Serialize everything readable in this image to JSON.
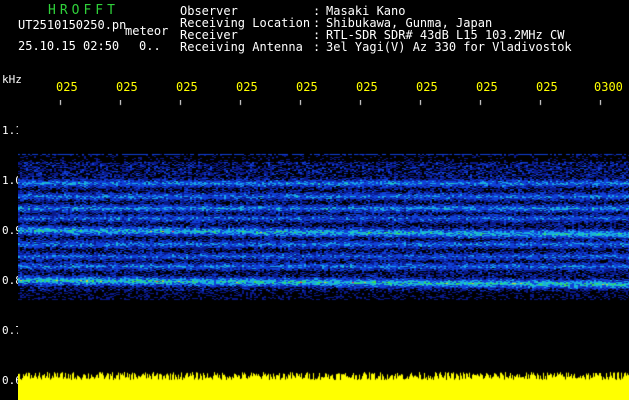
{
  "app": {
    "name": "HROFFT"
  },
  "file": {
    "name": "UT2510150250.pn",
    "mode": "meteor",
    "datetime": "25.10.15 02:50",
    "status": "0.."
  },
  "info": [
    {
      "key": "Observer",
      "value": "Masaki Kano"
    },
    {
      "key": "Receiving Location",
      "value": "Shibukawa, Gunma, Japan"
    },
    {
      "key": "Receiver",
      "value": "RTL-SDR SDR# 43dB L15 103.2MHz CW"
    },
    {
      "key": "Receiving Antenna",
      "value": "3el Yagi(V) Az 330 for Vladivostok"
    }
  ],
  "info_colon": ":",
  "y_axis": {
    "unit": "kHz",
    "ticks": [
      "1.1",
      "1.0",
      "0.9",
      "0.8",
      "0.7",
      "0.6"
    ]
  },
  "x_axis": {
    "labels": [
      "025",
      "025",
      "025",
      "025",
      "025",
      "025",
      "025",
      "025",
      "025",
      "0300"
    ]
  },
  "colors": {
    "label_text": "#ffffff",
    "time_labels": "#ffff00",
    "title": "#2fd13a",
    "noise_bar": "#ffff00",
    "spectrogram_background": "#000000"
  }
}
